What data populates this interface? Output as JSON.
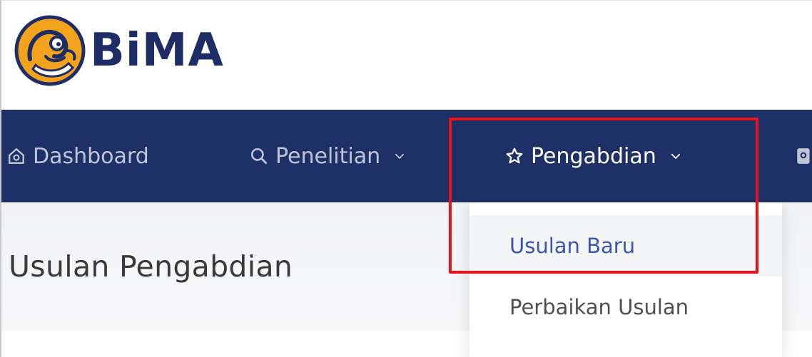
{
  "brand": {
    "name": "BiMA",
    "text_color": "#1f2d67",
    "accent_color": "#f2a21b"
  },
  "navbar": {
    "background": "#1d3068",
    "text_color": "#ffffff",
    "items": [
      {
        "label": "Dashboard",
        "icon": "home-icon",
        "has_dropdown": false
      },
      {
        "label": "Penelitian",
        "icon": "search-icon",
        "has_dropdown": true
      },
      {
        "label": "Pengabdian",
        "icon": "star-icon",
        "has_dropdown": true,
        "active": true
      },
      {
        "label": "",
        "icon": "document-search-icon",
        "has_dropdown": false
      }
    ]
  },
  "dropdown": {
    "items": [
      {
        "label": "Usulan Baru",
        "color": "#3b55b0"
      },
      {
        "label": "Perbaikan Usulan",
        "color": "#4f4f4f"
      }
    ]
  },
  "page": {
    "title": "Usulan Pengabdian",
    "title_color": "#3a3a3a"
  },
  "annotation": {
    "highlight_color": "#e8141b"
  }
}
